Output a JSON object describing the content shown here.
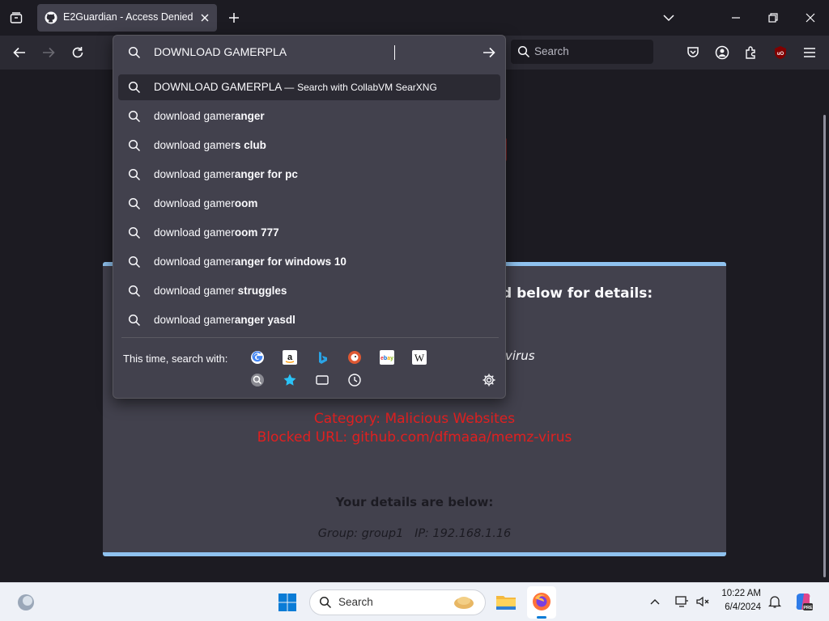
{
  "browser": {
    "tab_title": "E2Guardian - Access Denied",
    "toolbar_search_placeholder": "Search"
  },
  "urlbar": {
    "value": "DOWNLOAD GAMERPLA",
    "first_row": {
      "text": "DOWNLOAD GAMERPLA",
      "separator": "—",
      "engine_text": "Search with CollabVM SearXNG"
    },
    "suggestions": [
      {
        "prefix": "download gamer",
        "bold": "anger"
      },
      {
        "prefix": "download gamer",
        "bold": "s club"
      },
      {
        "prefix": "download gamer",
        "bold": "anger for pc"
      },
      {
        "prefix": "download gamer",
        "bold": "oom"
      },
      {
        "prefix": "download gamer",
        "bold": "oom 777"
      },
      {
        "prefix": "download gamer",
        "bold": "anger for windows 10"
      },
      {
        "prefix": "download gamer",
        "bold": " struggles"
      },
      {
        "prefix": "download gamer",
        "bold": "anger yasdl"
      }
    ],
    "search_with_label": "This time, search with:",
    "engines": [
      "google-icon",
      "amazon-icon",
      "bing-icon",
      "duckduckgo-icon",
      "ebay-icon",
      "wikipedia-icon",
      "searxng-icon",
      "bookmarks-icon",
      "tabs-icon",
      "history-icon"
    ]
  },
  "blockpage": {
    "heading_partial": "d below for details:",
    "reason_partial": "virus",
    "category_line": "Category: Malicious Websites",
    "blocked_line": "Blocked URL: github.com/dfmaaa/memz-virus",
    "details_heading": "Your details are below:",
    "group_label": "Group:",
    "group_value": "group1",
    "ip_label": "IP:",
    "ip_value": "192.168.1.16",
    "alert_color": "#e02020"
  },
  "taskbar": {
    "search_placeholder": "Search",
    "time": "10:22 AM",
    "date": "6/4/2024"
  }
}
